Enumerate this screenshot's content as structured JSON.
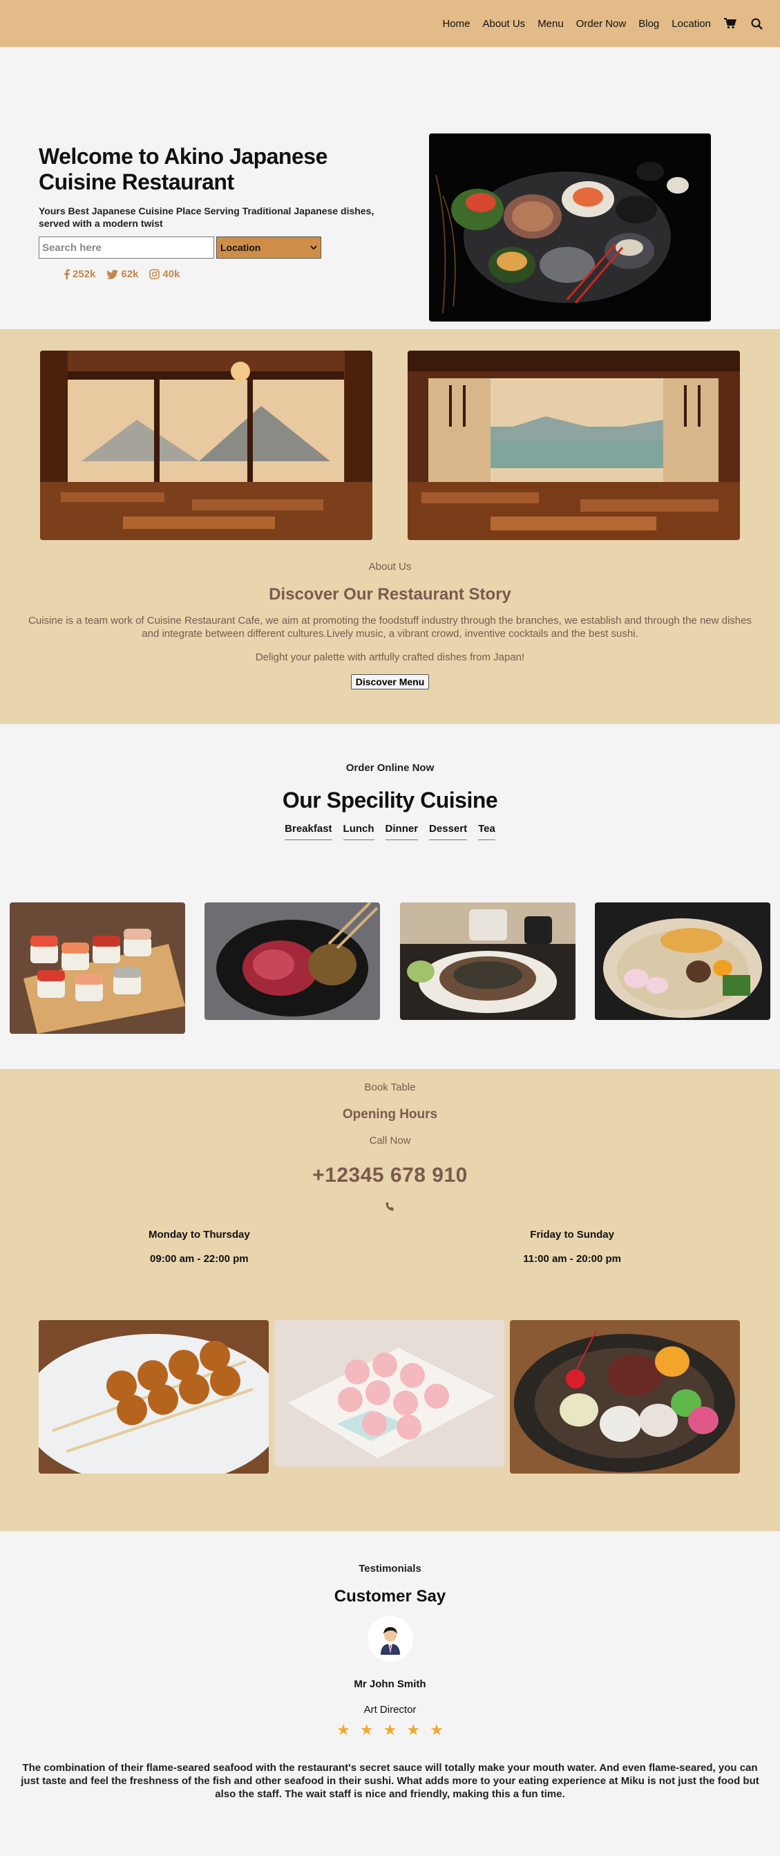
{
  "nav": {
    "items": [
      "Home",
      "About Us",
      "Menu",
      "Order Now",
      "Blog",
      "Location"
    ],
    "cart_icon": "cart-icon",
    "search_icon": "search-icon"
  },
  "hero": {
    "title": "Welcome to Akino Japanese Cuisine Restaurant",
    "subtitle": "Yours Best Japanese Cuisine Place Serving Traditional Japanese dishes, served with a modern twist",
    "search_placeholder": "Search here",
    "location_select": "Location",
    "social": [
      {
        "icon": "facebook-icon",
        "count": "252k"
      },
      {
        "icon": "twitter-icon",
        "count": "62k"
      },
      {
        "icon": "instagram-icon",
        "count": "40k"
      }
    ]
  },
  "about": {
    "eyebrow": "About Us",
    "title": "Discover Our Restaurant Story",
    "description": "Cuisine is a team work of Cuisine Restaurant Cafe, we aim at promoting the foodstuff industry through the branches, we establish and through the new dishes and integrate between different cultures.Lively music, a vibrant crowd, inventive cocktails and the best sushi.",
    "tagline": "Delight your palette with artfully crafted dishes from Japan!",
    "button": "Discover Menu"
  },
  "speciality": {
    "eyebrow": "Order Online Now",
    "title": "Our Specility Cuisine",
    "tabs": [
      "Breakfast",
      "Lunch",
      "Dinner",
      "Dessert",
      "Tea"
    ]
  },
  "hours": {
    "eyebrow": "Book Table",
    "title": "Opening Hours",
    "call": "Call Now",
    "phone": "+12345 678 910",
    "weekday": {
      "label": "Monday to Thursday",
      "time": "09:00 am - 22:00 pm"
    },
    "weekend": {
      "label": "Friday to Sunday",
      "time": "11:00 am - 20:00 pm"
    }
  },
  "testimonials": {
    "eyebrow": "Testimonials",
    "title": "Customer Say",
    "name": "Mr John Smith",
    "role": "Art Director",
    "rating": 5,
    "quote": "The combination of their flame-seared seafood with the restaurant's secret sauce will totally make your mouth water. And even flame-seared, you can just taste and feel the freshness of the fish and other seafood in their sushi. What adds more to your eating experience at Miku is not just the food but also the staff. The wait staff is nice and friendly, making this a fun time."
  },
  "colors": {
    "nav_bg": "#e2bb88",
    "section_bg": "#e8d4ad",
    "accent_brown": "#7a5a4d",
    "social_orange": "#c5874c",
    "star": "#f0a830"
  }
}
